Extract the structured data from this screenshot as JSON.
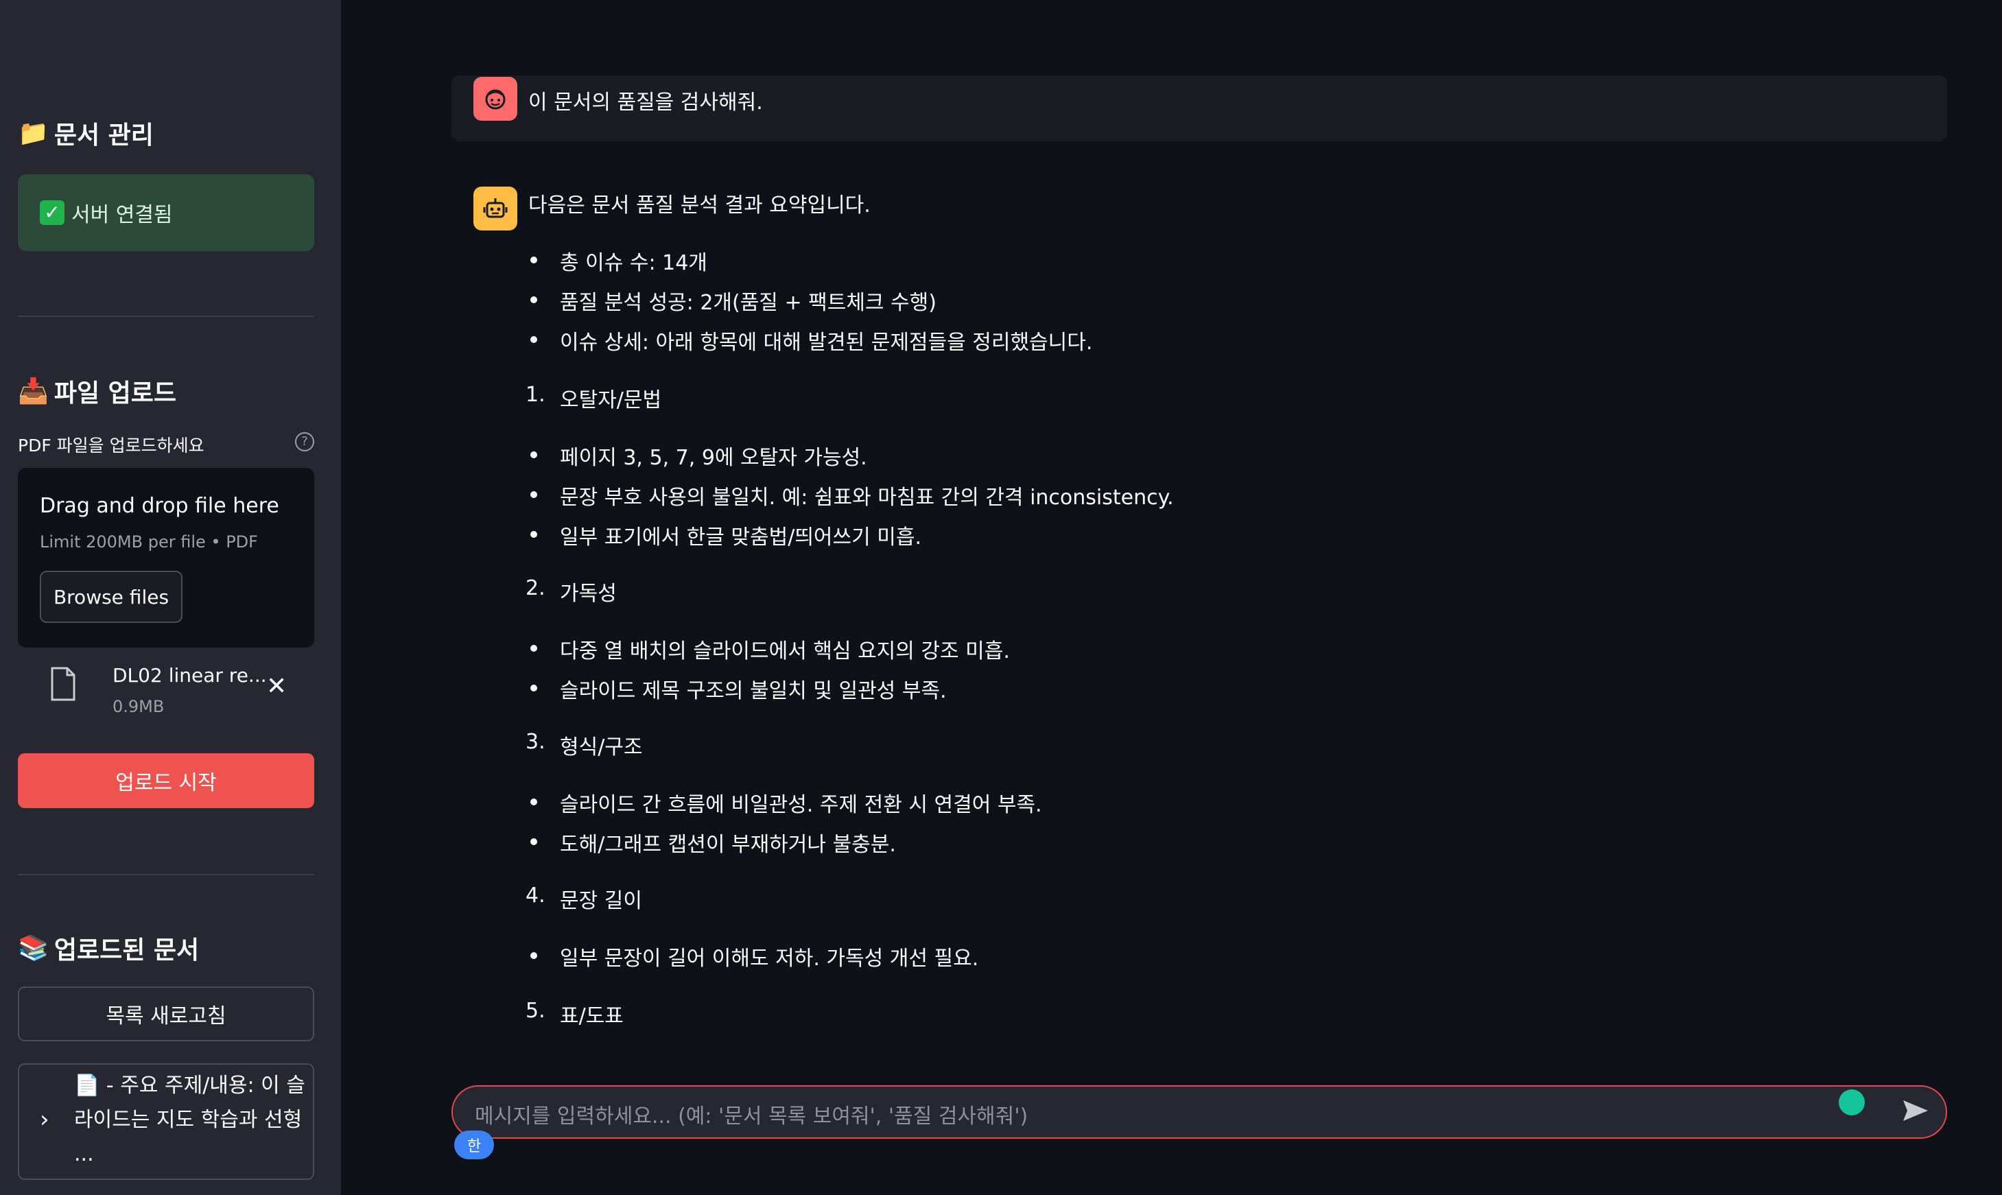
{
  "sidebar": {
    "doc_title": "문서 관리",
    "server_status": "서버 연결됨",
    "upload_title": "파일 업로드",
    "upload_label": "PDF 파일을 업로드하세요",
    "dropzone_title": "Drag and drop file here",
    "dropzone_limit": "Limit 200MB per file • PDF",
    "browse_label": "Browse files",
    "file": {
      "name": "DL02 linear re...",
      "size": "0.9MB"
    },
    "upload_button": "업로드 시작",
    "uploaded_title": "업로드된 문서",
    "refresh_button": "목록 새로고침",
    "expander_text": "- 주요 주제/내용: 이 슬라이드는 지도 학습과 선형 ..."
  },
  "chat": {
    "user_message": "이 문서의 품질을 검사해줘.",
    "assistant_intro": "다음은 문서 품질 분석 결과 요약입니다.",
    "summary": [
      "총 이슈 수: 14개",
      "품질 분석 성공: 2개(품질 + 팩트체크 수행)",
      "이슈 상세: 아래 항목에 대해 발견된 문제점들을 정리했습니다."
    ],
    "sections": [
      {
        "num": "1.",
        "title": "오탈자/문법",
        "items": [
          "페이지 3, 5, 7, 9에 오탈자 가능성.",
          "문장 부호 사용의 불일치. 예: 쉼표와 마침표 간의 간격 inconsistency.",
          "일부 표기에서 한글 맞춤법/띄어쓰기 미흡."
        ]
      },
      {
        "num": "2.",
        "title": "가독성",
        "items": [
          "다중 열 배치의 슬라이드에서 핵심 요지의 강조 미흡.",
          "슬라이드 제목 구조의 불일치 및 일관성 부족."
        ]
      },
      {
        "num": "3.",
        "title": "형식/구조",
        "items": [
          "슬라이드 간 흐름에 비일관성. 주제 전환 시 연결어 부족.",
          "도해/그래프 캡션이 부재하거나 불충분."
        ]
      },
      {
        "num": "4.",
        "title": "문장 길이",
        "items": [
          "일부 문장이 길어 이해도 저하. 가독성 개선 필요."
        ]
      },
      {
        "num": "5.",
        "title": "표/도표",
        "items": []
      }
    ],
    "input_placeholder": "메시지를 입력하세요... (예: '문서 목록 보여줘', '품질 검사해줘')",
    "ime_label": "한"
  }
}
